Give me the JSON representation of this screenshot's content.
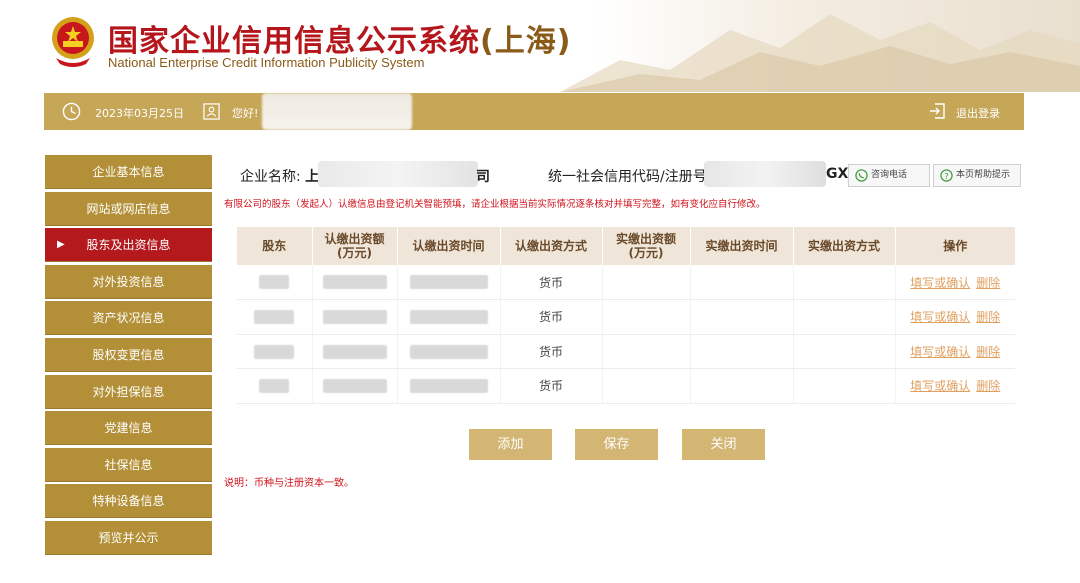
{
  "header": {
    "title_cn": "国家企业信用信息公示系统",
    "title_region": "(上海)",
    "title_en": "National Enterprise Credit Information Publicity System"
  },
  "topbar": {
    "date": "2023年03月25日",
    "greeting": "您好!",
    "logout": "退出登录"
  },
  "sidebar": {
    "items": [
      {
        "label": "企业基本信息"
      },
      {
        "label": "网站或网店信息"
      },
      {
        "label": "股东及出资信息"
      },
      {
        "label": "对外投资信息"
      },
      {
        "label": "资产状况信息"
      },
      {
        "label": "股权变更信息"
      },
      {
        "label": "对外担保信息"
      },
      {
        "label": "党建信息"
      },
      {
        "label": "社保信息"
      },
      {
        "label": "特种设备信息"
      },
      {
        "label": "预览并公示"
      }
    ],
    "active_index": 2
  },
  "info": {
    "company_label": "企业名称:",
    "company_prefix": "上",
    "company_suffix": "司",
    "code_label": "统一社会信用代码/注册号",
    "code_suffix": "GX\\",
    "consult_button": "咨询电话",
    "help_button": "本页帮助提示"
  },
  "notice": "有限公司的股东（发起人）认缴信息由登记机关智能预填，请企业根据当前实际情况逐条核对并填写完整，如有变化应自行修改。",
  "table": {
    "headers": [
      "股东",
      "认缴出资额\n(万元)",
      "认缴出资时间",
      "认缴出资方式",
      "实缴出资额\n(万元)",
      "实缴出资时间",
      "实缴出资方式",
      "操作"
    ],
    "rows": [
      {
        "method": "货币",
        "action_edit": "填写或确认",
        "action_delete": "删除"
      },
      {
        "method": "货币",
        "action_edit": "填写或确认",
        "action_delete": "删除"
      },
      {
        "method": "货币",
        "action_edit": "填写或确认",
        "action_delete": "删除"
      },
      {
        "method": "货币",
        "action_edit": "填写或确认",
        "action_delete": "删除"
      }
    ]
  },
  "buttons": {
    "add": "添加",
    "save": "保存",
    "close": "关闭"
  },
  "footnote": "说明：币种与注册资本一致。",
  "colors": {
    "brand_red": "#b5161c",
    "gold": "#c6a657",
    "sidebar_gold": "#b39038",
    "active_red": "#b4191e",
    "notice_red": "#d0121b",
    "link_orange": "#e0a060"
  }
}
